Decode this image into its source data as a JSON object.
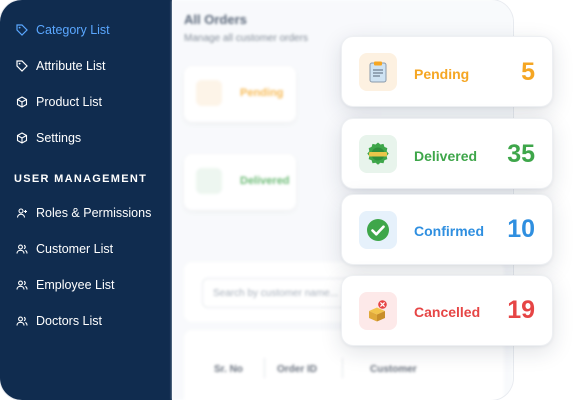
{
  "sidebar": {
    "items": [
      {
        "label": "Category List",
        "icon": "tag-icon",
        "active": true
      },
      {
        "label": "Attribute List",
        "icon": "tag-icon"
      },
      {
        "label": "Product List",
        "icon": "box-icon"
      },
      {
        "label": "Settings",
        "icon": "box-icon"
      }
    ],
    "section_heading": "USER MANAGEMENT",
    "user_items": [
      {
        "label": "Roles & Permissions",
        "icon": "user-plus-icon"
      },
      {
        "label": "Customer List",
        "icon": "users-icon"
      },
      {
        "label": "Employee List",
        "icon": "users-icon"
      },
      {
        "label": "Doctors List",
        "icon": "users-icon"
      }
    ]
  },
  "main": {
    "title": "All Orders",
    "subtitle": "Manage all customer orders",
    "bg_cards": [
      {
        "label": "Pending"
      },
      {
        "label": "Delivered"
      }
    ],
    "search_placeholder": "Search by customer name...",
    "table_headers": [
      "Sr. No",
      "Order ID",
      "Customer"
    ]
  },
  "stats": [
    {
      "label": "Pending",
      "value": "5",
      "icon": "clipboard-icon",
      "color": "#f5a623",
      "bg": "#fdf1e1"
    },
    {
      "label": "Delivered",
      "value": "35",
      "icon": "delivered-badge-icon",
      "color": "#3ea64a",
      "bg": "#e8f4ec"
    },
    {
      "label": "Confirmed",
      "value": "10",
      "icon": "check-circle-icon",
      "color": "#2f8fe0",
      "bg": "#e6f1fb"
    },
    {
      "label": "Cancelled",
      "value": "19",
      "icon": "cancelled-package-icon",
      "color": "#e64545",
      "bg": "#fde9e9"
    }
  ],
  "colors": {
    "sidebar_bg": "#102c4f",
    "active_link": "#5aa7ff"
  }
}
